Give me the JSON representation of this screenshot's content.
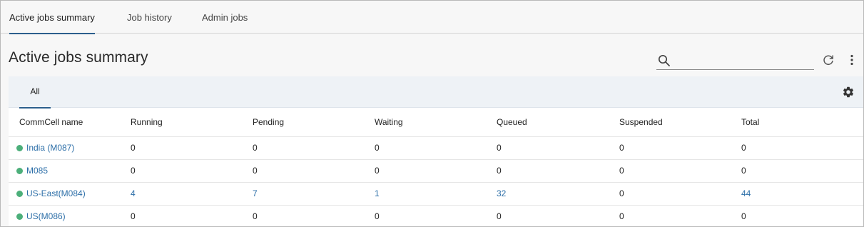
{
  "tabs": [
    {
      "label": "Active jobs summary",
      "active": true
    },
    {
      "label": "Job history",
      "active": false
    },
    {
      "label": "Admin jobs",
      "active": false
    }
  ],
  "page_title": "Active jobs summary",
  "search": {
    "placeholder": "",
    "value": ""
  },
  "subtabs": [
    {
      "label": "All",
      "active": true
    }
  ],
  "colors": {
    "accent": "#2c5f8d",
    "link": "#2d6fa8",
    "status_online": "#4caf7a"
  },
  "icons": [
    "search-icon",
    "refresh-icon",
    "more-vertical-icon",
    "gear-icon"
  ],
  "table": {
    "columns": [
      "CommCell name",
      "Running",
      "Pending",
      "Waiting",
      "Queued",
      "Suspended",
      "Total"
    ],
    "rows": [
      {
        "name": "India (M087)",
        "status": "online",
        "running": "0",
        "pending": "0",
        "waiting": "0",
        "queued": "0",
        "suspended": "0",
        "total": "0"
      },
      {
        "name": "M085",
        "status": "online",
        "running": "0",
        "pending": "0",
        "waiting": "0",
        "queued": "0",
        "suspended": "0",
        "total": "0"
      },
      {
        "name": "US-East(M084)",
        "status": "online",
        "running": "4",
        "pending": "7",
        "waiting": "1",
        "queued": "32",
        "suspended": "0",
        "total": "44"
      },
      {
        "name": "US(M086)",
        "status": "online",
        "running": "0",
        "pending": "0",
        "waiting": "0",
        "queued": "0",
        "suspended": "0",
        "total": "0"
      }
    ]
  }
}
